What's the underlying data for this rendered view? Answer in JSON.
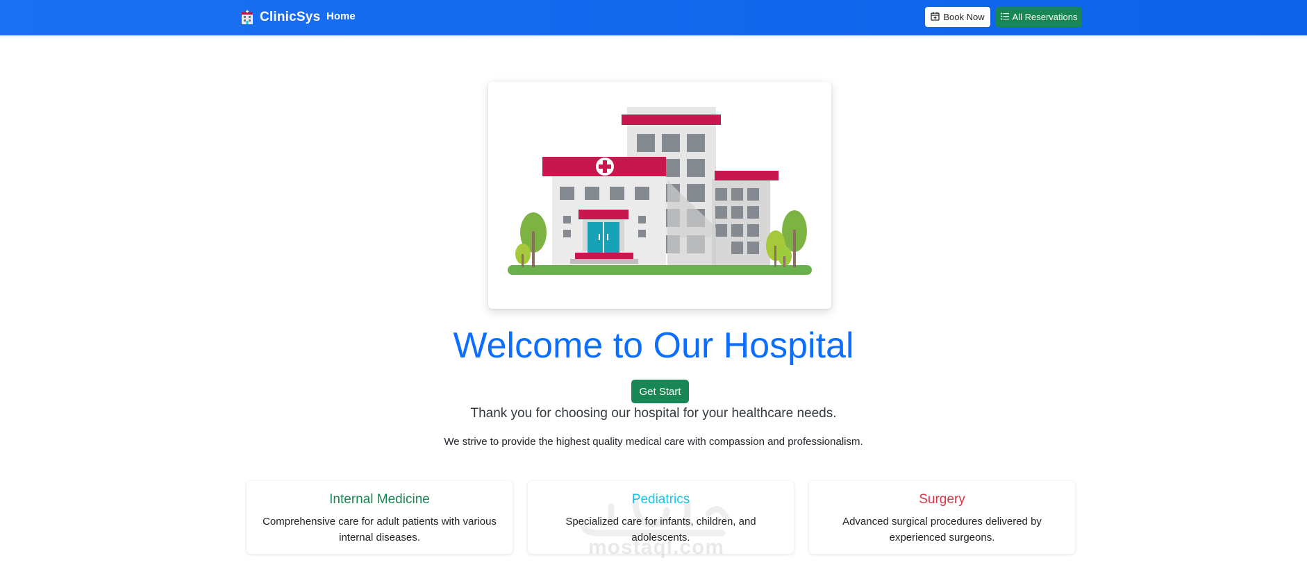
{
  "navbar": {
    "brand": "ClinicSys",
    "brand_icon": "hospital-building-icon",
    "home_label": "Home",
    "book_label": "Book Now",
    "book_icon": "calendar-plus-icon",
    "reservations_label": "All Reservations",
    "reservations_icon": "list-icon"
  },
  "hero": {
    "image": "hospital-illustration",
    "title": "Welcome to Our Hospital",
    "cta_label": "Get Start",
    "lead": "Thank you for choosing our hospital for your healthcare needs.",
    "subtitle": "We strive to provide the highest quality medical care with compassion and professionalism."
  },
  "services": [
    {
      "title": "Internal Medicine",
      "description": "Comprehensive care for adult patients with various internal diseases.",
      "color": "#198754"
    },
    {
      "title": "Pediatrics",
      "description": "Specialized care for infants, children, and adolescents.",
      "color": "#0dcaf0"
    },
    {
      "title": "Surgery",
      "description": "Advanced surgical procedures delivered by experienced surgeons.",
      "color": "#dc3545"
    }
  ],
  "watermark": "mostaql.com",
  "colors": {
    "navbar": "#0d63e8",
    "primary": "#0d6efd",
    "success": "#198754",
    "accent_red": "#c8174f"
  }
}
